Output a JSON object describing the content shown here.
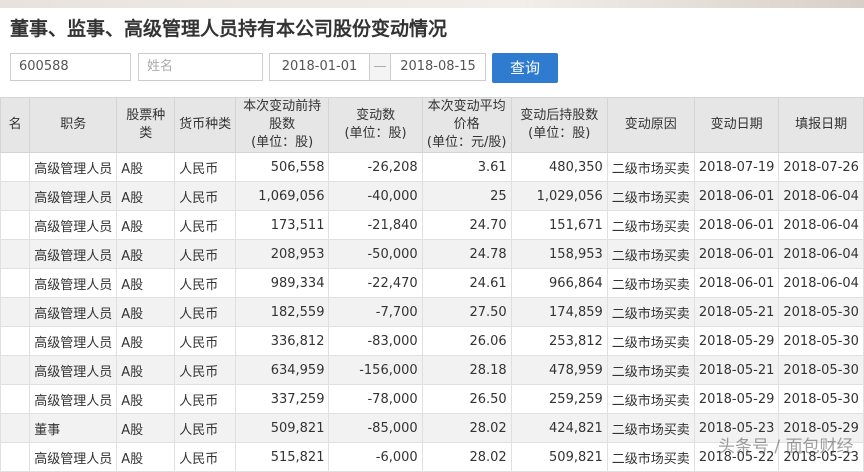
{
  "title": "董事、监事、高级管理人员持有本公司股份变动情况",
  "search": {
    "code": "600588",
    "name_placeholder": "姓名",
    "start_date": "2018-01-01",
    "separator": "—",
    "end_date": "2018-08-15",
    "query_label": "查询"
  },
  "headers": [
    "名",
    "职务",
    "股票种类",
    "货币种类",
    "本次变动前持股数\n(单位：股)",
    "变动数\n(单位：股)",
    "本次变动平均价格\n(单位：元/股)",
    "变动后持股数\n(单位：股)",
    "变动原因",
    "变动日期",
    "填报日期"
  ],
  "rows": [
    [
      "",
      "高级管理人员",
      "A股",
      "人民币",
      "506,558",
      "-26,208",
      "3.61",
      "480,350",
      "二级市场买卖",
      "2018-07-19",
      "2018-07-26"
    ],
    [
      "",
      "高级管理人员",
      "A股",
      "人民币",
      "1,069,056",
      "-40,000",
      "25",
      "1,029,056",
      "二级市场买卖",
      "2018-06-01",
      "2018-06-04"
    ],
    [
      "",
      "高级管理人员",
      "A股",
      "人民币",
      "173,511",
      "-21,840",
      "24.70",
      "151,671",
      "二级市场买卖",
      "2018-06-01",
      "2018-06-04"
    ],
    [
      "",
      "高级管理人员",
      "A股",
      "人民币",
      "208,953",
      "-50,000",
      "24.78",
      "158,953",
      "二级市场买卖",
      "2018-06-01",
      "2018-06-04"
    ],
    [
      "",
      "高级管理人员",
      "A股",
      "人民币",
      "989,334",
      "-22,470",
      "24.61",
      "966,864",
      "二级市场买卖",
      "2018-06-01",
      "2018-06-04"
    ],
    [
      "",
      "高级管理人员",
      "A股",
      "人民币",
      "182,559",
      "-7,700",
      "27.50",
      "174,859",
      "二级市场买卖",
      "2018-05-21",
      "2018-05-30"
    ],
    [
      "",
      "高级管理人员",
      "A股",
      "人民币",
      "336,812",
      "-83,000",
      "26.06",
      "253,812",
      "二级市场买卖",
      "2018-05-29",
      "2018-05-30"
    ],
    [
      "",
      "高级管理人员",
      "A股",
      "人民币",
      "634,959",
      "-156,000",
      "28.18",
      "478,959",
      "二级市场买卖",
      "2018-05-21",
      "2018-05-30"
    ],
    [
      "",
      "高级管理人员",
      "A股",
      "人民币",
      "337,259",
      "-78,000",
      "26.50",
      "259,259",
      "二级市场买卖",
      "2018-05-29",
      "2018-05-30"
    ],
    [
      "",
      "董事",
      "A股",
      "人民币",
      "509,821",
      "-85,000",
      "28.02",
      "424,821",
      "二级市场买卖",
      "2018-05-23",
      "2018-05-29"
    ],
    [
      "",
      "高级管理人员",
      "A股",
      "人民币",
      "515,821",
      "-6,000",
      "28.02",
      "509,821",
      "二级市场买卖",
      "2018-05-22",
      "2018-05-23"
    ]
  ],
  "watermark": "头条号 / 面包财经"
}
